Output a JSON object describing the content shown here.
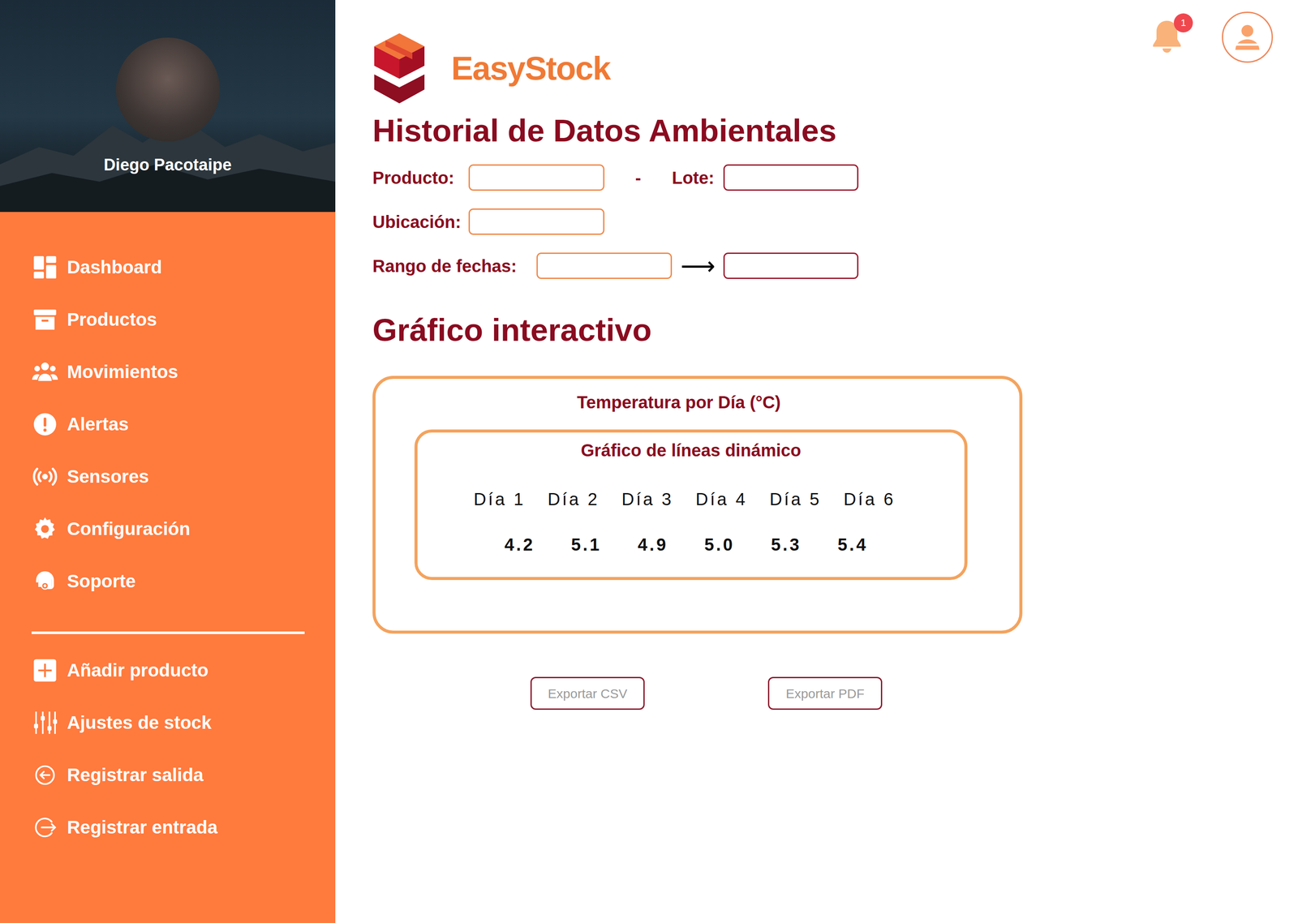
{
  "sidebar": {
    "user": {
      "name": "Diego Pacotaipe"
    },
    "items": [
      {
        "label": "Dashboard",
        "kind": "dashboard"
      },
      {
        "label": "Productos",
        "kind": "box"
      },
      {
        "label": "Movimientos",
        "kind": "users"
      },
      {
        "label": "Alertas",
        "kind": "alert"
      },
      {
        "label": "Sensores",
        "kind": "sensor"
      },
      {
        "label": "Configuración",
        "kind": "gear"
      },
      {
        "label": "Soporte",
        "kind": "support"
      }
    ],
    "actions": [
      {
        "label": "Añadir producto",
        "kind": "plus"
      },
      {
        "label": "Ajustes de stock",
        "kind": "sliders"
      },
      {
        "label": "Registrar salida",
        "kind": "logout"
      },
      {
        "label": "Registrar entrada",
        "kind": "login"
      }
    ]
  },
  "brand": {
    "name": "EasyStock"
  },
  "header": {
    "notifications": {
      "count": "1"
    }
  },
  "page": {
    "title": "Historial de Datos Ambientales",
    "chart_heading": "Gráfico interactivo"
  },
  "filters": {
    "product": {
      "label": "Producto:"
    },
    "separator": "-",
    "lot": {
      "label": "Lote:"
    },
    "location": {
      "label": "Ubicación:"
    },
    "dates": {
      "label": "Rango de fechas:",
      "arrow": "⟶"
    }
  },
  "chart": {
    "title": "Temperatura por Día (°C)",
    "subtitle": "Gráfico de líneas dinámico",
    "points": [
      {
        "label": "Día 1",
        "value": "4.2"
      },
      {
        "label": "Día 2",
        "value": "5.1"
      },
      {
        "label": "Día 3",
        "value": "4.9"
      },
      {
        "label": "Día 4",
        "value": "5.0"
      },
      {
        "label": "Día 5",
        "value": "5.3"
      },
      {
        "label": "Día 6",
        "value": "5.4"
      }
    ]
  },
  "buttons": [
    "Exportar CSV",
    "Exportar PDF"
  ]
}
